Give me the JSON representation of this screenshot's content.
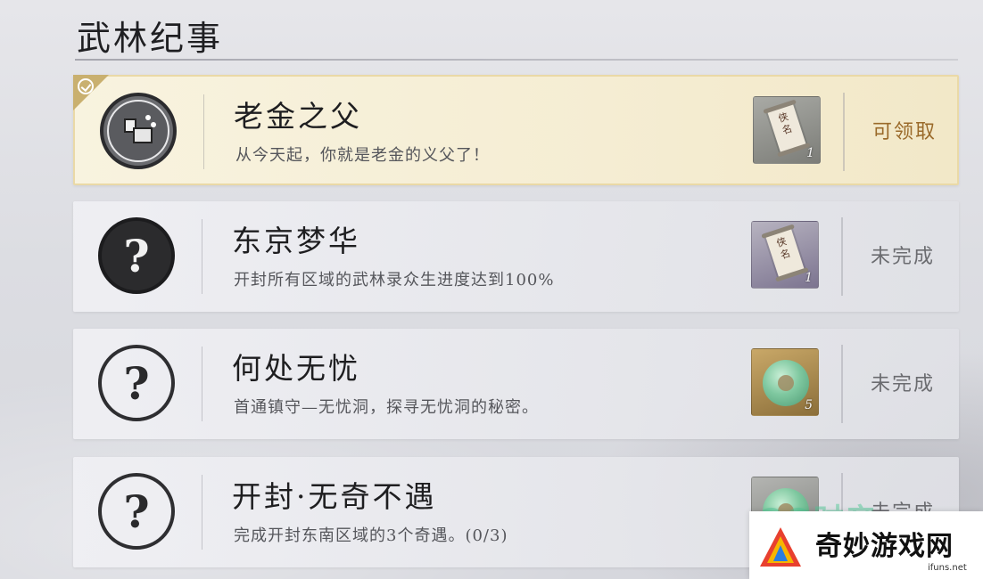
{
  "header": {
    "title": "武林纪事"
  },
  "entries": [
    {
      "title": "老金之父",
      "description": "从今天起，你就是老金的义父了！",
      "reward": {
        "icon": "scroll-icon",
        "scroll_text": "侠名",
        "count": "1"
      },
      "status": "可领取",
      "state": "claimable"
    },
    {
      "title": "东京梦华",
      "description": "开封所有区域的武林录众生进度达到100%",
      "reward": {
        "icon": "scroll-icon",
        "scroll_text": "侠名",
        "count": "1"
      },
      "status": "未完成",
      "state": "locked"
    },
    {
      "title": "何处无忧",
      "description": "首通镇守—无忧洞，探寻无忧洞的秘密。",
      "reward": {
        "icon": "jade-ring-icon",
        "count": "5"
      },
      "status": "未完成",
      "state": "locked"
    },
    {
      "title": "开封·无奇不遇",
      "description": "完成开封东南区域的3个奇遇。(0/3)",
      "reward": {
        "icon": "jade-ring-icon",
        "count": ""
      },
      "status": "未完成",
      "state": "locked"
    }
  ],
  "watermark": {
    "text": "奇妙游戏网",
    "site": "ifuns.net",
    "overlay": "QQ时产"
  },
  "colors": {
    "claimable_bg": "#f6eed6",
    "claimable_border": "#ead9a6",
    "status_ready": "#9a6a2a",
    "status_locked": "#6b6c70"
  }
}
